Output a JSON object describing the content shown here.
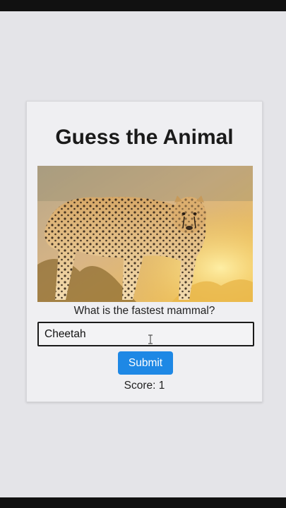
{
  "game": {
    "title": "Guess the Animal",
    "image_subject": "cheetah",
    "question": "What is the fastest mammal?",
    "answer_value": "Cheetah",
    "submit_label": "Submit",
    "score_text": "Score: 1"
  },
  "colors": {
    "accent": "#1e88e5",
    "background": "#e4e4e8",
    "card": "#efeff2"
  },
  "icons": {
    "text_cursor": "i-beam-cursor-icon"
  }
}
